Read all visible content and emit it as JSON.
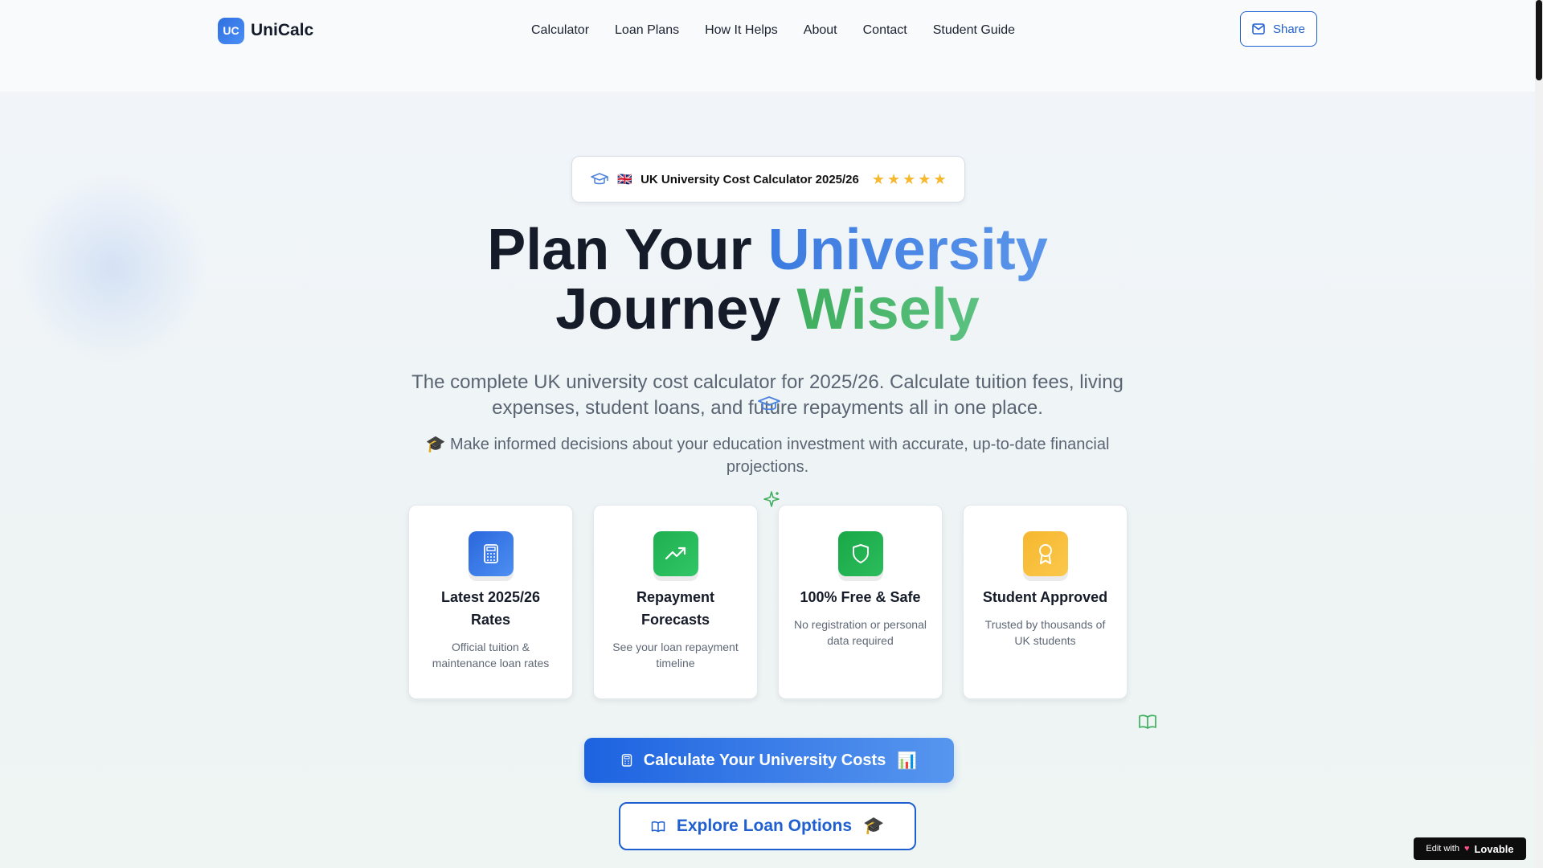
{
  "header": {
    "logo_badge": "UC",
    "logo_text": "UniCalc",
    "nav": [
      "Calculator",
      "Loan Plans",
      "How It Helps",
      "About",
      "Contact",
      "Student Guide"
    ],
    "share_label": "Share"
  },
  "hero": {
    "pill": {
      "flag": "🇬🇧",
      "text": "UK University Cost Calculator 2025/26",
      "rating": 5
    },
    "headline": {
      "line1_a": "Plan Your ",
      "line1_b": "University",
      "line2_a": "Journey ",
      "line2_b": "Wisely"
    },
    "subtitle": "The complete UK university cost calculator for 2025/26. Calculate tuition fees, living expenses, student loans, and future repayments all in one place.",
    "subtitle2": "🎓 Make informed decisions about your education investment with accurate, up-to-date financial projections."
  },
  "cards": [
    {
      "title": "Latest 2025/26 Rates",
      "desc": "Official tuition & maintenance loan rates",
      "icon": "calculator-icon",
      "color": "#2f6fe0"
    },
    {
      "title": "Repayment Forecasts",
      "desc": "See your loan repayment timeline",
      "icon": "trending-up-icon",
      "color": "#22b554"
    },
    {
      "title": "100% Free & Safe",
      "desc": "No registration or personal data required",
      "icon": "shield-icon",
      "color": "#1fae4c"
    },
    {
      "title": "Student Approved",
      "desc": "Trusted by thousands of UK students",
      "icon": "award-icon",
      "color": "#f7bd3a"
    }
  ],
  "cta": {
    "primary_label": "Calculate Your University Costs",
    "primary_emoji": "📊",
    "secondary_label": "Explore Loan Options",
    "secondary_emoji": "🎓"
  },
  "badge": {
    "prefix": "Edit with",
    "brand": "Lovable"
  },
  "colors": {
    "accent_blue": "#1f5fd0",
    "accent_green": "#3fae5e",
    "star": "#f5b82e"
  }
}
